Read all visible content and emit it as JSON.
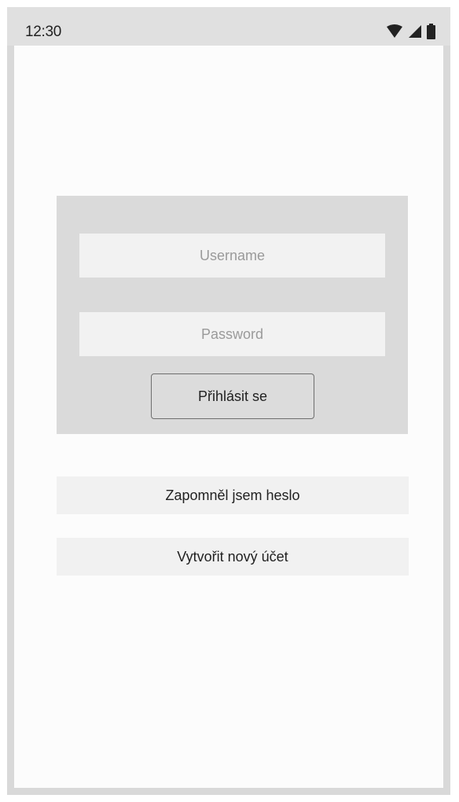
{
  "status_bar": {
    "time": "12:30",
    "icons": [
      "wifi-icon",
      "cellular-signal-icon",
      "battery-icon"
    ]
  },
  "login": {
    "username_placeholder": "Username",
    "password_placeholder": "Password",
    "submit_label": "Přihlásit se"
  },
  "links": {
    "forgot_password": "Zapomněl jsem heslo",
    "create_account": "Vytvořit nový účet"
  },
  "colors": {
    "status_bar_bg": "#e0e0e0",
    "panel_bg": "#dadada",
    "field_bg": "#f2f2f2",
    "link_bg": "#f1f1f1"
  }
}
